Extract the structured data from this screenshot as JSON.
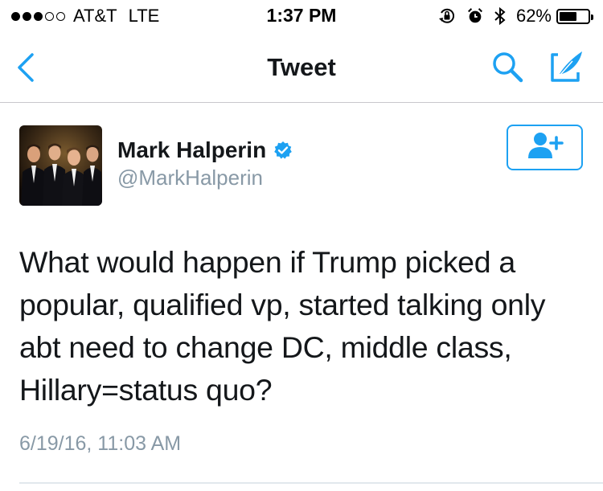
{
  "status_bar": {
    "carrier": "AT&T",
    "network": "LTE",
    "time": "1:37 PM",
    "battery_percent": "62%",
    "battery_level": 0.62,
    "signal_bars_filled": 3,
    "signal_bars_total": 5
  },
  "nav": {
    "title": "Tweet",
    "back_icon": "chevron-left-icon",
    "search_icon": "search-icon",
    "compose_icon": "compose-icon"
  },
  "tweet": {
    "user_name": "Mark Halperin",
    "handle": "@MarkHalperin",
    "verified": true,
    "text": "What would happen if Trump picked a popular, qualified vp, started talking only abt need to change DC, middle class, Hillary=status quo?",
    "timestamp": "6/19/16, 11:03 AM",
    "follow_icon": "add-user-icon"
  },
  "colors": {
    "accent": "#1da1f2",
    "text": "#14171a",
    "secondary_text": "#8899a6",
    "divider": "#c8c7cc"
  }
}
